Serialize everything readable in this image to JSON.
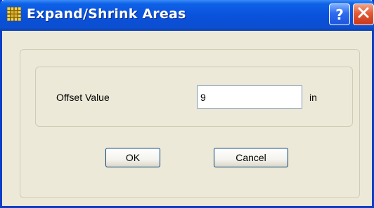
{
  "window": {
    "title": "Expand/Shrink Areas",
    "icon": "grid-app-icon",
    "titlebar_buttons": [
      {
        "name": "help",
        "glyph": "?"
      },
      {
        "name": "close",
        "glyph": "✕"
      }
    ]
  },
  "form": {
    "offset_label": "Offset Value",
    "offset_value": "9",
    "offset_unit": "in"
  },
  "buttons": {
    "ok_label": "OK",
    "cancel_label": "Cancel"
  },
  "colors": {
    "titlebar": "#0a54de",
    "dialog_background": "#ece9d8",
    "close_button": "#e35a35"
  }
}
